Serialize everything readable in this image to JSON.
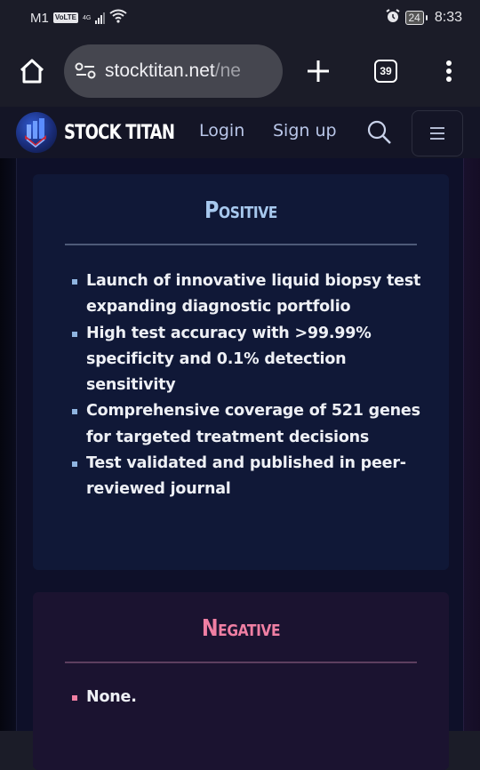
{
  "status_bar": {
    "carrier": "M1",
    "volte": "VoLTE",
    "network": "4G",
    "battery": "24",
    "time": "8:33"
  },
  "browser": {
    "url_domain": "stocktitan.net",
    "url_path": "/ne",
    "tab_count": "39"
  },
  "site_header": {
    "brand": "STOCK TITAN",
    "login": "Login",
    "signup": "Sign up"
  },
  "positive": {
    "title": "Positive",
    "accent": "#a7c8ee",
    "items": [
      "Launch of innovative liquid biopsy test expanding diagnostic portfolio",
      "High test accuracy with >99.99% specificity and 0.1% detection sensitivity",
      "Comprehensive coverage of 521 genes for targeted treatment decisions",
      "Test validated and published in peer-reviewed journal"
    ]
  },
  "negative": {
    "title": "Negative",
    "accent": "#f07fa3",
    "items": [
      "None."
    ]
  }
}
